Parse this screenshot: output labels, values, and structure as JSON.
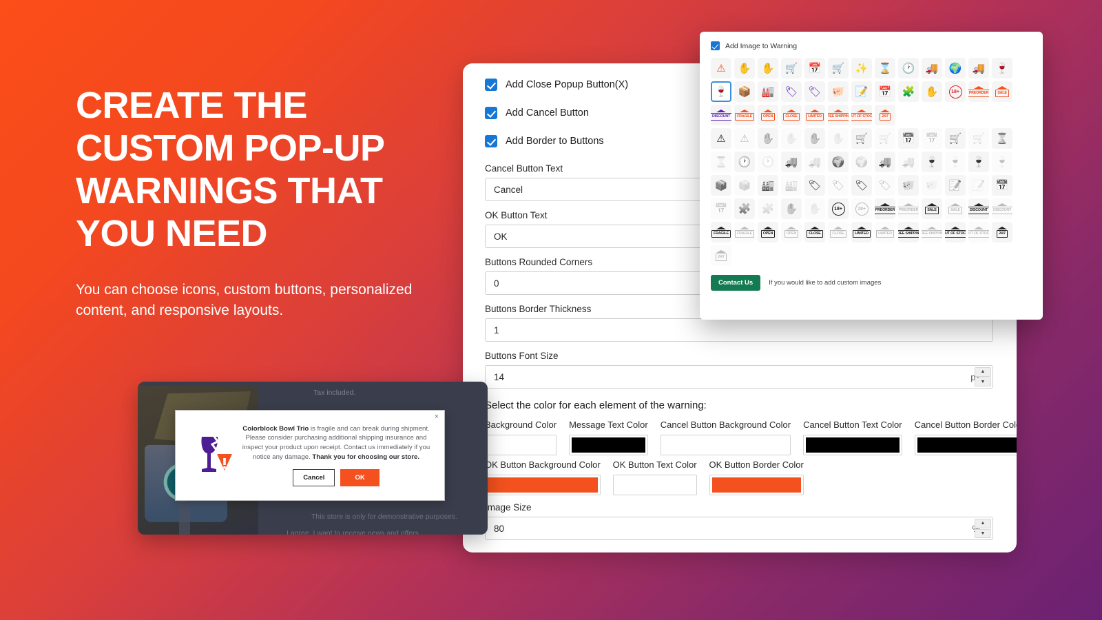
{
  "hero": {
    "headline": "CREATE THE CUSTOM POP-UP WARNINGS THAT YOU NEED",
    "subhead": "You can choose icons, custom buttons, personalized content, and responsive layouts."
  },
  "form": {
    "checkboxes": [
      {
        "label": "Add Close Popup Button(X)",
        "checked": true
      },
      {
        "label": "Add Cancel Button",
        "checked": true
      },
      {
        "label": "Add Border to Buttons",
        "checked": true
      }
    ],
    "fields": [
      {
        "label": "Cancel Button Text",
        "value": "Cancel",
        "unit": ""
      },
      {
        "label": "OK Button Text",
        "value": "OK",
        "unit": ""
      },
      {
        "label": "Buttons Rounded Corners",
        "value": "0",
        "unit": ""
      },
      {
        "label": "Buttons Border Thickness",
        "value": "1",
        "unit": ""
      },
      {
        "label": "Buttons Font Size",
        "value": "14",
        "unit": "px"
      }
    ],
    "color_section_title": "Select the color for each element of the warning:",
    "colors_row1": [
      {
        "label": "Background Color",
        "value": "#ffffff"
      },
      {
        "label": "Message Text Color",
        "value": "#000000"
      },
      {
        "label": "Cancel Button Background Color",
        "value": "#ffffff"
      },
      {
        "label": "Cancel Button Text Color",
        "value": "#000000"
      },
      {
        "label": "Cancel Button Border Color",
        "value": "#000000"
      }
    ],
    "colors_row2": [
      {
        "label": "OK Button Background Color",
        "value": "#f4511e"
      },
      {
        "label": "OK Button Text Color",
        "value": "#ffffff"
      },
      {
        "label": "OK Button Border Color",
        "value": "#f4511e"
      }
    ],
    "image_size": {
      "label": "Image Size",
      "value": "80",
      "unit": "%"
    }
  },
  "icon_panel": {
    "checkbox_label": "Add Image to Warning",
    "contact_button": "Contact Us",
    "contact_note": "If you would like to add custom images",
    "selected_index": 13,
    "icons": [
      {
        "name": "warning-triangle-icon",
        "glyph": "⚠",
        "color": "#f4511e",
        "kind": "glyph"
      },
      {
        "name": "stop-hand-icon",
        "glyph": "✋",
        "color": "#5b21b6",
        "kind": "glyph"
      },
      {
        "name": "stop-hand-warning-icon",
        "glyph": "✋",
        "color": "#5b21b6",
        "kind": "glyph"
      },
      {
        "name": "cart-alert-icon",
        "glyph": "🛒",
        "color": "#f4511e",
        "kind": "glyph"
      },
      {
        "name": "calendar-cart-icon",
        "glyph": "📅",
        "color": "#5b21b6",
        "kind": "glyph"
      },
      {
        "name": "cart-box-icon",
        "glyph": "🛒",
        "color": "#5b21b6",
        "kind": "glyph"
      },
      {
        "name": "sparkle-alert-icon",
        "glyph": "✨",
        "color": "#f4c20d",
        "kind": "glyph"
      },
      {
        "name": "hourglass-icon",
        "glyph": "⌛",
        "color": "#5b21b6",
        "kind": "glyph"
      },
      {
        "name": "clock-alert-icon",
        "glyph": "🕐",
        "color": "#5b21b6",
        "kind": "glyph"
      },
      {
        "name": "delivery-truck-icon",
        "glyph": "🚚",
        "color": "#f4511e",
        "kind": "glyph"
      },
      {
        "name": "globe-pin-icon",
        "glyph": "🌍",
        "color": "#5b21b6",
        "kind": "glyph"
      },
      {
        "name": "free-shipping-truck-icon",
        "glyph": "🚚",
        "color": "#f4511e",
        "kind": "glyph"
      },
      {
        "name": "wine-glass-icon",
        "glyph": "🍷",
        "color": "#f4511e",
        "kind": "glyph"
      },
      {
        "name": "broken-wine-glass-icon",
        "glyph": "🍷",
        "color": "#5b21b6",
        "kind": "glyph"
      },
      {
        "name": "fragile-box-icon",
        "glyph": "📦",
        "color": "#5b21b6",
        "kind": "glyph"
      },
      {
        "name": "warehouse-icon",
        "glyph": "🏭",
        "color": "#f4511e",
        "kind": "glyph"
      },
      {
        "name": "price-tag-icon",
        "glyph": "🏷",
        "color": "#5b21b6",
        "kind": "glyph"
      },
      {
        "name": "discount-tag-icon",
        "glyph": "🏷",
        "color": "#5b21b6",
        "kind": "glyph"
      },
      {
        "name": "piggy-bank-icon",
        "glyph": "🐖",
        "color": "#f4511e",
        "kind": "glyph"
      },
      {
        "name": "order-form-icon",
        "glyph": "📝",
        "color": "#f4511e",
        "kind": "glyph"
      },
      {
        "name": "calendar-alert-icon",
        "glyph": "📅",
        "color": "#5b21b6",
        "kind": "glyph"
      },
      {
        "name": "puzzle-icon",
        "glyph": "🧩",
        "color": "#5b21b6",
        "kind": "glyph"
      },
      {
        "name": "hand-18-icon",
        "glyph": "✋",
        "color": "#5b21b6",
        "kind": "glyph"
      },
      {
        "name": "age-18-plus-icon",
        "glyph": "18+",
        "color": "#d81f26",
        "kind": "badge"
      },
      {
        "name": "preorder-sign-icon",
        "glyph": "PREORDER",
        "color": "#f4511e",
        "kind": "sign"
      },
      {
        "name": "sale-sign-icon",
        "glyph": "SALE",
        "color": "#f4511e",
        "kind": "sign"
      },
      {
        "name": "discount-sign-icon",
        "glyph": "DISCOUNT",
        "color": "#5b21b6",
        "kind": "sign"
      },
      {
        "name": "fragile-sign-icon",
        "glyph": "FRAGILE",
        "color": "#f4511e",
        "kind": "sign"
      },
      {
        "name": "open-sign-icon",
        "glyph": "OPEN",
        "color": "#f4511e",
        "kind": "sign"
      },
      {
        "name": "close-sign-icon",
        "glyph": "CLOSE",
        "color": "#f4511e",
        "kind": "sign"
      },
      {
        "name": "limited-sign-icon",
        "glyph": "LIMITED",
        "color": "#f4511e",
        "kind": "sign"
      },
      {
        "name": "free-shipping-sign-icon",
        "glyph": "FREE SHIPPING",
        "color": "#f4511e",
        "kind": "sign"
      },
      {
        "name": "out-of-stock-sign-icon",
        "glyph": "OUT OF STOCK",
        "color": "#f4511e",
        "kind": "sign"
      },
      {
        "name": "24-7-sign-icon",
        "glyph": "24/7",
        "color": "#f4511e",
        "kind": "sign"
      }
    ],
    "mono_icons": [
      {
        "name": "warning-triangle-icon",
        "glyph": "⚠",
        "kind": "glyph"
      },
      {
        "name": "warning-triangle-outline-icon",
        "glyph": "⚠",
        "kind": "glyph",
        "faded": true
      },
      {
        "name": "stop-hand-icon",
        "glyph": "✋",
        "kind": "glyph"
      },
      {
        "name": "stop-hand-outline-icon",
        "glyph": "✋",
        "kind": "glyph",
        "faded": true
      },
      {
        "name": "stop-hand-warning-icon",
        "glyph": "✋",
        "kind": "glyph"
      },
      {
        "name": "stop-hand-warning-outline-icon",
        "glyph": "✋",
        "kind": "glyph",
        "faded": true
      },
      {
        "name": "cart-alert-icon",
        "glyph": "🛒",
        "kind": "glyph"
      },
      {
        "name": "cart-alert-outline-icon",
        "glyph": "🛒",
        "kind": "glyph",
        "faded": true
      },
      {
        "name": "calendar-cart-icon",
        "glyph": "📅",
        "kind": "glyph"
      },
      {
        "name": "calendar-cart-outline-icon",
        "glyph": "📅",
        "kind": "glyph",
        "faded": true
      },
      {
        "name": "cart-box-icon",
        "glyph": "🛒",
        "kind": "glyph"
      },
      {
        "name": "cart-box-outline-icon",
        "glyph": "🛒",
        "kind": "glyph",
        "faded": true
      },
      {
        "name": "hourglass-icon",
        "glyph": "⌛",
        "kind": "glyph"
      },
      {
        "name": "hourglass-outline-icon",
        "glyph": "⌛",
        "kind": "glyph",
        "faded": true
      },
      {
        "name": "clock-alert-icon",
        "glyph": "🕐",
        "kind": "glyph"
      },
      {
        "name": "clock-alert-outline-icon",
        "glyph": "🕐",
        "kind": "glyph",
        "faded": true
      },
      {
        "name": "delivery-truck-icon",
        "glyph": "🚚",
        "kind": "glyph"
      },
      {
        "name": "delivery-truck-outline-icon",
        "glyph": "🚚",
        "kind": "glyph",
        "faded": true
      },
      {
        "name": "globe-pin-icon",
        "glyph": "🌍",
        "kind": "glyph"
      },
      {
        "name": "globe-pin-outline-icon",
        "glyph": "🌍",
        "kind": "glyph",
        "faded": true
      },
      {
        "name": "free-shipping-truck-icon",
        "glyph": "🚚",
        "kind": "glyph"
      },
      {
        "name": "free-shipping-truck-outline-icon",
        "glyph": "🚚",
        "kind": "glyph",
        "faded": true
      },
      {
        "name": "wine-glass-icon",
        "glyph": "🍷",
        "kind": "glyph"
      },
      {
        "name": "wine-glass-outline-icon",
        "glyph": "🍷",
        "kind": "glyph",
        "faded": true
      },
      {
        "name": "broken-wine-glass-icon",
        "glyph": "🍷",
        "kind": "glyph"
      },
      {
        "name": "broken-wine-glass-outline-icon",
        "glyph": "🍷",
        "kind": "glyph",
        "faded": true
      },
      {
        "name": "fragile-box-icon",
        "glyph": "📦",
        "kind": "glyph"
      },
      {
        "name": "fragile-box-outline-icon",
        "glyph": "📦",
        "kind": "glyph",
        "faded": true
      },
      {
        "name": "warehouse-icon",
        "glyph": "🏭",
        "kind": "glyph"
      },
      {
        "name": "warehouse-outline-icon",
        "glyph": "🏭",
        "kind": "glyph",
        "faded": true
      },
      {
        "name": "price-tag-icon",
        "glyph": "🏷",
        "kind": "glyph"
      },
      {
        "name": "price-tag-outline-icon",
        "glyph": "🏷",
        "kind": "glyph",
        "faded": true
      },
      {
        "name": "discount-tag-icon",
        "glyph": "🏷",
        "kind": "glyph"
      },
      {
        "name": "discount-tag-outline-icon",
        "glyph": "🏷",
        "kind": "glyph",
        "faded": true
      },
      {
        "name": "piggy-bank-icon",
        "glyph": "🐖",
        "kind": "glyph"
      },
      {
        "name": "piggy-bank-outline-icon",
        "glyph": "🐖",
        "kind": "glyph",
        "faded": true
      },
      {
        "name": "order-form-icon",
        "glyph": "📝",
        "kind": "glyph"
      },
      {
        "name": "order-form-outline-icon",
        "glyph": "📝",
        "kind": "glyph",
        "faded": true
      },
      {
        "name": "calendar-alert-icon",
        "glyph": "📅",
        "kind": "glyph"
      },
      {
        "name": "calendar-alert-outline-icon",
        "glyph": "📅",
        "kind": "glyph",
        "faded": true
      },
      {
        "name": "puzzle-icon",
        "glyph": "🧩",
        "kind": "glyph"
      },
      {
        "name": "puzzle-outline-icon",
        "glyph": "🧩",
        "kind": "glyph",
        "faded": true
      },
      {
        "name": "hand-18-icon",
        "glyph": "✋",
        "kind": "glyph"
      },
      {
        "name": "hand-18-outline-icon",
        "glyph": "✋",
        "kind": "glyph",
        "faded": true
      },
      {
        "name": "age-18-plus-icon",
        "glyph": "18+",
        "kind": "badge"
      },
      {
        "name": "age-18-plus-outline-icon",
        "glyph": "18+",
        "kind": "badge",
        "faded": true
      },
      {
        "name": "preorder-sign-icon",
        "glyph": "PREORDER",
        "kind": "sign"
      },
      {
        "name": "preorder-sign-outline-icon",
        "glyph": "PREORDER",
        "kind": "sign",
        "faded": true
      },
      {
        "name": "sale-sign-icon",
        "glyph": "SALE",
        "kind": "sign"
      },
      {
        "name": "sale-sign-outline-icon",
        "glyph": "SALE",
        "kind": "sign",
        "faded": true
      },
      {
        "name": "discount-sign-icon",
        "glyph": "DISCOUNT",
        "kind": "sign"
      },
      {
        "name": "discount-sign-outline-icon",
        "glyph": "DISCOUNT",
        "kind": "sign",
        "faded": true
      },
      {
        "name": "fragile-sign-icon",
        "glyph": "FRAGILE",
        "kind": "sign"
      },
      {
        "name": "fragile-sign-outline-icon",
        "glyph": "FRAGILE",
        "kind": "sign",
        "faded": true
      },
      {
        "name": "open-sign-icon",
        "glyph": "OPEN",
        "kind": "sign"
      },
      {
        "name": "open-sign-outline-icon",
        "glyph": "OPEN",
        "kind": "sign",
        "faded": true
      },
      {
        "name": "close-sign-icon",
        "glyph": "CLOSE",
        "kind": "sign"
      },
      {
        "name": "close-sign-outline-icon",
        "glyph": "CLOSE",
        "kind": "sign",
        "faded": true
      },
      {
        "name": "limited-sign-icon",
        "glyph": "LIMITED",
        "kind": "sign"
      },
      {
        "name": "limited-sign-outline-icon",
        "glyph": "LIMITED",
        "kind": "sign",
        "faded": true
      },
      {
        "name": "free-shipping-sign-icon",
        "glyph": "FREE SHIPPING",
        "kind": "sign"
      },
      {
        "name": "free-shipping-sign-outline-icon",
        "glyph": "FREE SHIPPING",
        "kind": "sign",
        "faded": true
      },
      {
        "name": "out-of-stock-sign-icon",
        "glyph": "OUT OF STOCK",
        "kind": "sign"
      },
      {
        "name": "out-of-stock-sign-outline-icon",
        "glyph": "OUT OF STOCK",
        "kind": "sign",
        "faded": true
      },
      {
        "name": "24-7-sign-icon",
        "glyph": "24/7",
        "kind": "sign"
      },
      {
        "name": "24-7-sign-outline-icon",
        "glyph": "24/7",
        "kind": "sign",
        "faded": true
      }
    ]
  },
  "preview": {
    "store_tax_note": "Tax included.",
    "store_demo_note": "This store is only for demonstrative purposes.",
    "store_demo_note2": "I agree, I want to receive news and offers.",
    "popup": {
      "close_label": "×",
      "message_lead": "Colorblock Bowl Trio",
      "message_body": " is fragile and can break during shipment. Please consider purchasing additional shipping insurance and inspect your product upon receipt. Contact us immediately if you notice any damage. ",
      "message_tail": "Thank you for choosing our store.",
      "cancel_label": "Cancel",
      "ok_label": "OK"
    }
  }
}
